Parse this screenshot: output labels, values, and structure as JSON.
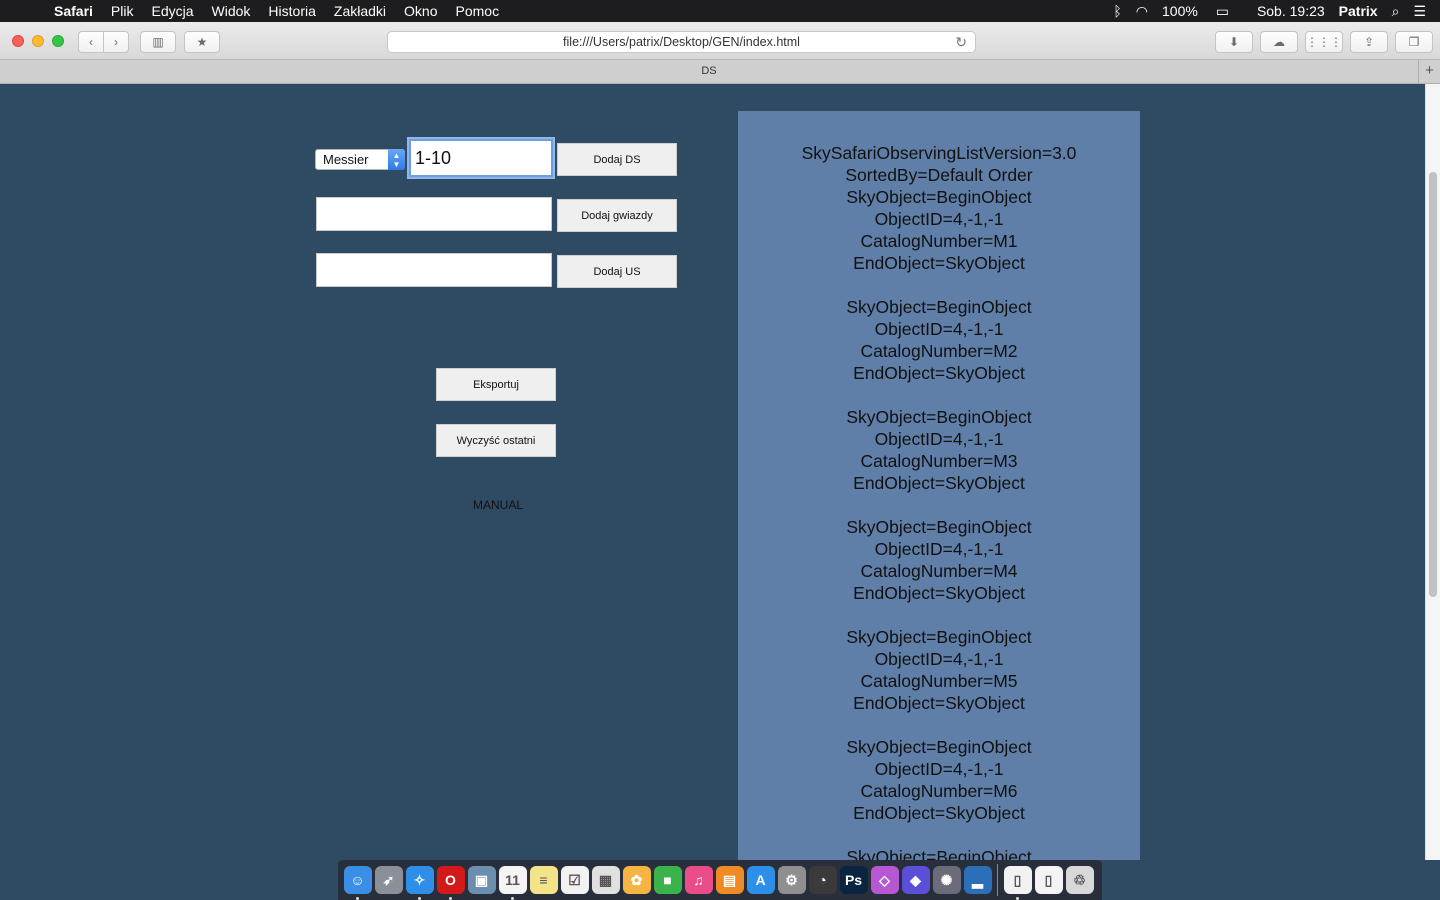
{
  "menubar": {
    "app_name": "Safari",
    "items": [
      "Plik",
      "Edycja",
      "Widok",
      "Historia",
      "Zakładki",
      "Okno",
      "Pomoc"
    ],
    "status": {
      "battery": "100%",
      "clock": "Sob. 19:23",
      "user": "Patrix"
    }
  },
  "browser": {
    "url": "file:///Users/patrix/Desktop/GEN/index.html",
    "tab_title": "DS"
  },
  "form": {
    "catalog_select": "Messier",
    "ds_input_value": "1-10",
    "stars_input_value": "",
    "us_input_value": "",
    "add_ds_label": "Dodaj DS",
    "add_stars_label": "Dodaj gwiazdy",
    "add_us_label": "Dodaj US",
    "export_label": "Eksportuj",
    "clear_last_label": "Wyczyść ostatni",
    "manual_label": "MANUAL"
  },
  "output": {
    "header": [
      "SkySafariObservingListVersion=3.0",
      "SortedBy=Default Order"
    ],
    "objects": [
      [
        "SkyObject=BeginObject",
        "ObjectID=4,-1,-1",
        "CatalogNumber=M1",
        "EndObject=SkyObject"
      ],
      [
        "SkyObject=BeginObject",
        "ObjectID=4,-1,-1",
        "CatalogNumber=M2",
        "EndObject=SkyObject"
      ],
      [
        "SkyObject=BeginObject",
        "ObjectID=4,-1,-1",
        "CatalogNumber=M3",
        "EndObject=SkyObject"
      ],
      [
        "SkyObject=BeginObject",
        "ObjectID=4,-1,-1",
        "CatalogNumber=M4",
        "EndObject=SkyObject"
      ],
      [
        "SkyObject=BeginObject",
        "ObjectID=4,-1,-1",
        "CatalogNumber=M5",
        "EndObject=SkyObject"
      ],
      [
        "SkyObject=BeginObject",
        "ObjectID=4,-1,-1",
        "CatalogNumber=M6",
        "EndObject=SkyObject"
      ],
      [
        "SkyObject=BeginObject"
      ]
    ]
  },
  "dock": {
    "apps": [
      {
        "icon": "finder-icon",
        "color": "#3a8ee6",
        "glyph": "☺"
      },
      {
        "icon": "launchpad-icon",
        "color": "#8a8f98",
        "glyph": "➶"
      },
      {
        "icon": "safari-icon",
        "color": "#2f8ee8",
        "glyph": "✧"
      },
      {
        "icon": "opera-icon",
        "color": "#d31a1a",
        "glyph": "O"
      },
      {
        "icon": "preview-icon",
        "color": "#6c8fb0",
        "glyph": "▣"
      },
      {
        "icon": "calendar-icon",
        "color": "#f4f4f4",
        "glyph": "11"
      },
      {
        "icon": "notes-icon",
        "color": "#f3e48a",
        "glyph": "≡"
      },
      {
        "icon": "reminders-icon",
        "color": "#f2f2f2",
        "glyph": "☑"
      },
      {
        "icon": "photos-preview-icon",
        "color": "#e0e0e0",
        "glyph": "▦"
      },
      {
        "icon": "photos-icon",
        "color": "#f6b443",
        "glyph": "✿"
      },
      {
        "icon": "facetime-icon",
        "color": "#3ab44a",
        "glyph": "■"
      },
      {
        "icon": "itunes-icon",
        "color": "#ea4c89",
        "glyph": "♫"
      },
      {
        "icon": "ibooks-icon",
        "color": "#f08a24",
        "glyph": "▤"
      },
      {
        "icon": "app-store-icon",
        "color": "#2c8fea",
        "glyph": "A"
      },
      {
        "icon": "system-preferences-icon",
        "color": "#8f8f8f",
        "glyph": "⚙"
      },
      {
        "icon": "activity-monitor-icon",
        "color": "#3a3a3a",
        "glyph": "◔"
      },
      {
        "icon": "photoshop-icon",
        "color": "#0a2540",
        "glyph": "Ps"
      },
      {
        "icon": "affinity-icon",
        "color": "#b657d4",
        "glyph": "◇"
      },
      {
        "icon": "crystal-icon",
        "color": "#5a4fd6",
        "glyph": "◆"
      },
      {
        "icon": "compressor-icon",
        "color": "#6b6b7a",
        "glyph": "✺"
      },
      {
        "icon": "desktop-folder-icon",
        "color": "#2a6fb8",
        "glyph": "▂"
      },
      {
        "icon": "document-icon",
        "color": "#f2f2f2",
        "glyph": "▯"
      },
      {
        "icon": "downloads-stack-icon",
        "color": "#f4f4f4",
        "glyph": "▯"
      },
      {
        "icon": "trash-icon",
        "color": "#d8d8d8",
        "glyph": "♲"
      }
    ]
  }
}
